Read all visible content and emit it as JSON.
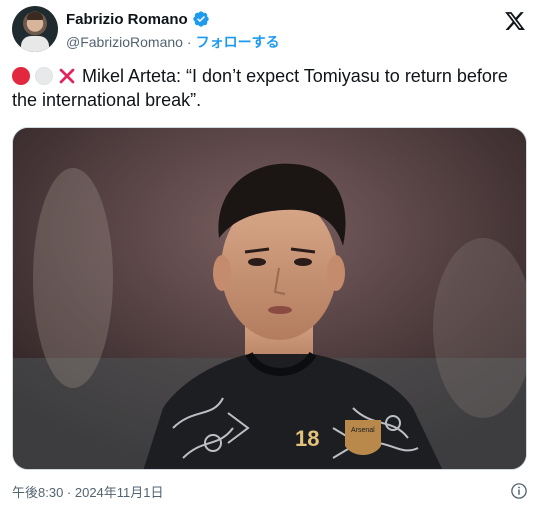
{
  "author": {
    "display_name": "Fabrizio Romano",
    "handle": "@FabrizioRomano",
    "separator": "·",
    "follow_label": "フォローする"
  },
  "tweet": {
    "text": "Mikel Arteta: “I don’t expect Tomiyasu to return before the international break”."
  },
  "media": {
    "jersey_number": "18",
    "crest_text": "Arsenal"
  },
  "footer": {
    "timestamp": "午後8:30 · 2024年11月1日"
  },
  "colors": {
    "accent": "#1d9bf0",
    "text": "#0f1419",
    "secondary": "#536471",
    "emoji_red": "#e1283f",
    "emoji_cross": "#e0245e"
  },
  "icons": [
    "verified-badge-icon",
    "x-logo-icon",
    "info-icon"
  ]
}
